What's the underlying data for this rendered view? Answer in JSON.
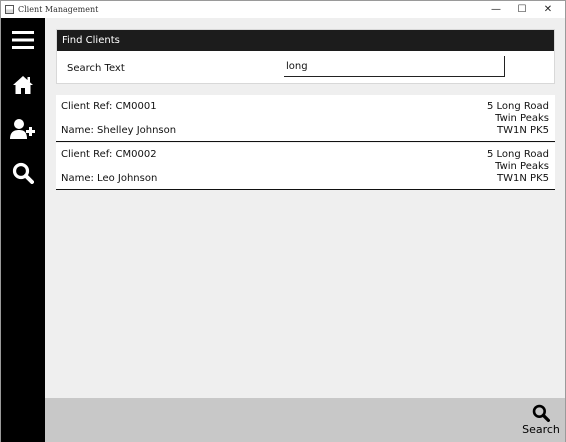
{
  "window": {
    "title": "Client Management",
    "controls": {
      "minimize": "—",
      "maximize": "☐",
      "close": "✕"
    }
  },
  "sidebar": {
    "items": [
      {
        "name": "menu",
        "icon": "hamburger-menu-icon"
      },
      {
        "name": "home",
        "icon": "home-icon"
      },
      {
        "name": "add-user",
        "icon": "add-user-icon"
      },
      {
        "name": "search",
        "icon": "search-icon"
      }
    ]
  },
  "find": {
    "header": "Find Clients",
    "search_label": "Search Text",
    "search_value": "long"
  },
  "results": [
    {
      "ref_label": "Client Ref: CM0001",
      "name_label": "Name: Shelley Johnson",
      "address": [
        "5 Long Road",
        "Twin Peaks",
        "TW1N PK5"
      ]
    },
    {
      "ref_label": "Client Ref: CM0002",
      "name_label": "Name: Leo Johnson",
      "address": [
        "5 Long Road",
        "Twin Peaks",
        "TW1N PK5"
      ]
    }
  ],
  "bottombar": {
    "search_label": "Search",
    "search_icon": "search-icon"
  },
  "colors": {
    "sidebar": "#000000",
    "header": "#1c1c1c",
    "main_bg": "#efefef",
    "bottom_bar": "#c8c8c8"
  }
}
